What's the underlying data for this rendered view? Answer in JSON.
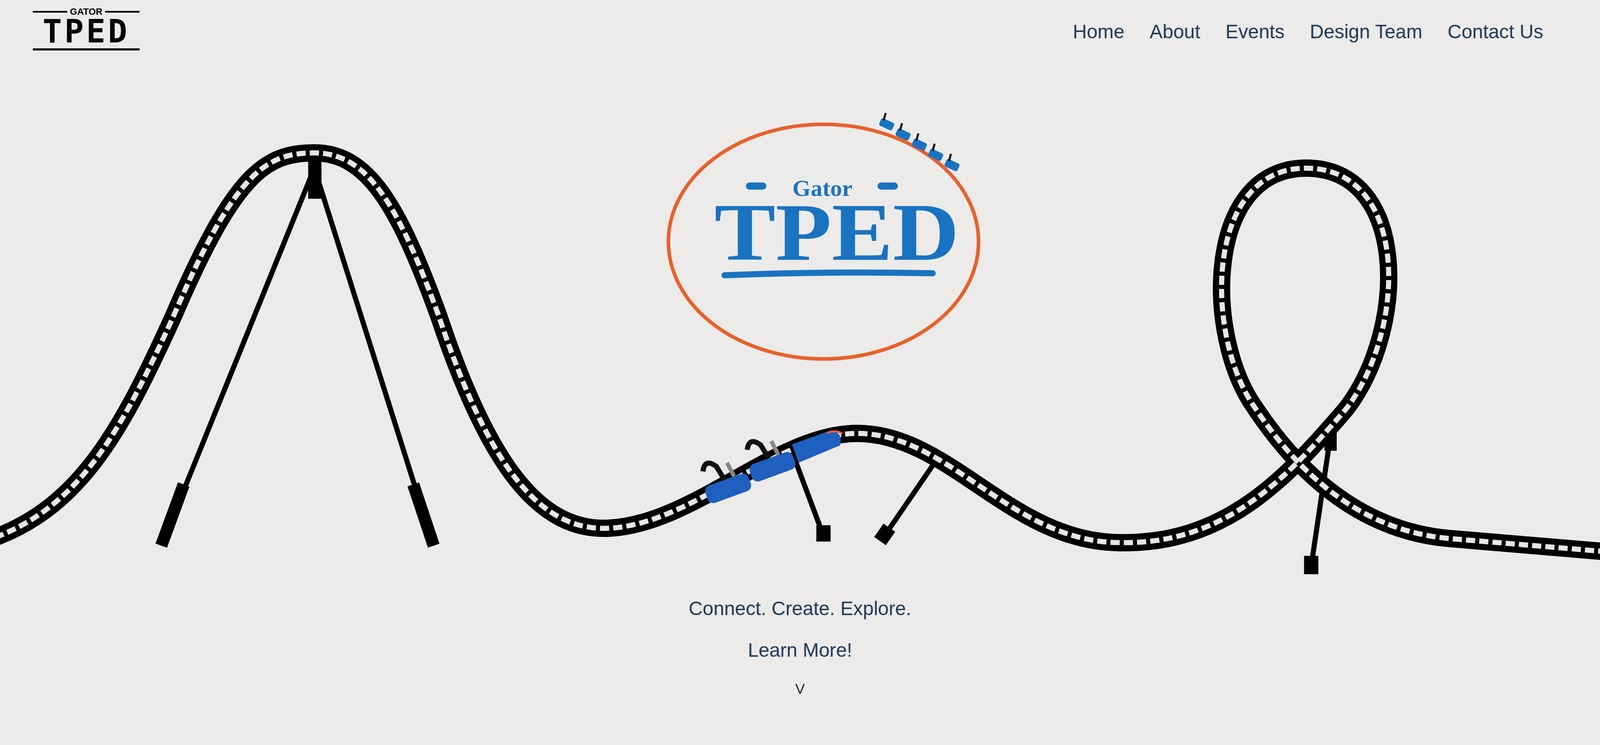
{
  "header": {
    "logo": {
      "top": "GATOR",
      "main": "TPED"
    },
    "nav": [
      {
        "label": "Home"
      },
      {
        "label": "About"
      },
      {
        "label": "Events"
      },
      {
        "label": "Design Team"
      },
      {
        "label": "Contact Us"
      }
    ]
  },
  "hero": {
    "logo": {
      "top": "Gator",
      "main": "TPED"
    },
    "tagline": "Connect. Create. Explore.",
    "cta": "Learn More!",
    "scroll": "V"
  }
}
